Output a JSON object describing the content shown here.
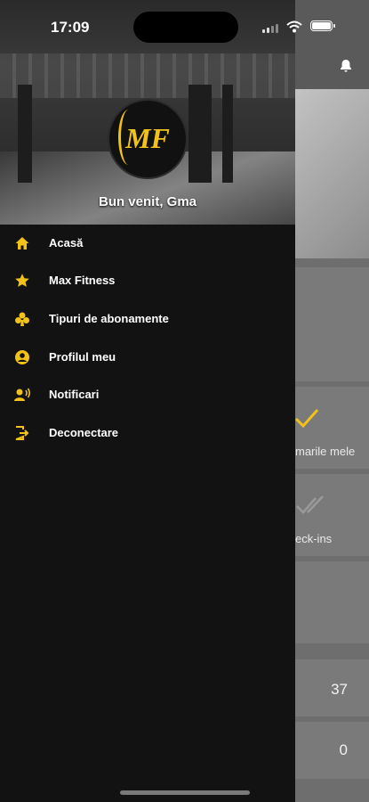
{
  "status_bar": {
    "time": "17:09"
  },
  "drawer": {
    "welcome": "Bun venit, Gma",
    "logo_text": "MF",
    "items": [
      {
        "label": "Acasă",
        "icon": "home-icon"
      },
      {
        "label": "Max Fitness",
        "icon": "star-icon"
      },
      {
        "label": "Tipuri de abonamente",
        "icon": "club-icon"
      },
      {
        "label": "Profilul meu",
        "icon": "profile-icon"
      },
      {
        "label": "Notificari",
        "icon": "notification-icon"
      },
      {
        "label": "Deconectare",
        "icon": "logout-icon"
      }
    ]
  },
  "background": {
    "card1_label": "marile mele",
    "card2_label": "eck-ins",
    "stat1": "37",
    "stat2": "0"
  },
  "colors": {
    "accent": "#f2c21b",
    "drawer_bg": "#121212"
  }
}
